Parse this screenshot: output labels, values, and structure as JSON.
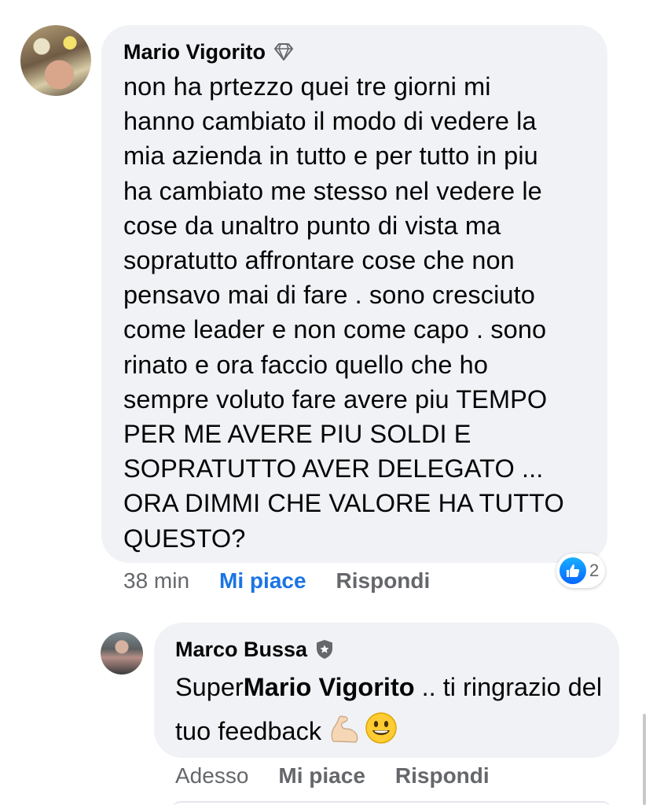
{
  "comments": [
    {
      "author": "Mario Vigorito",
      "badge_icon": "diamond-icon",
      "text": "non ha prtezzo quei tre giorni mi\nhanno cambiato il modo di vedere la\nmia azienda in tutto e per tutto in piu\nha cambiato me stesso nel vedere le\ncose da unaltro punto di vista ma\nsopratutto affrontare cose che non\npensavo mai di fare . sono cresciuto\ncome leader e non come capo . sono\nrinato e ora faccio quello che ho\nsempre voluto fare avere piu TEMPO\nPER ME AVERE PIU SOLDI  E\nSOPRATUTTO AVER DELEGATO ...\nORA DIMMI CHE VALORE HA TUTTO\nQUESTO?",
      "time": "38 min",
      "like_label": "Mi piace",
      "reply_label": "Rispondi",
      "reaction_icon": "like-icon",
      "reaction_count": "2",
      "like_color": "#1b74e4"
    },
    {
      "author": "Marco Bussa",
      "badge_icon": "shield-icon",
      "text_prefix": "Super",
      "mention": "Mario Vigorito",
      "text_suffix": " .. ti ringrazio del tuo feedback ",
      "emojis": [
        "flexed-biceps-emoji",
        "smiling-face-emoji"
      ],
      "time": "Adesso",
      "like_label": "Mi piace",
      "reply_label": "Rispondi"
    }
  ],
  "colors": {
    "bubble": "#f0f2f5",
    "text": "#050505",
    "secondary": "#65676b",
    "accent": "#1b74e4"
  }
}
